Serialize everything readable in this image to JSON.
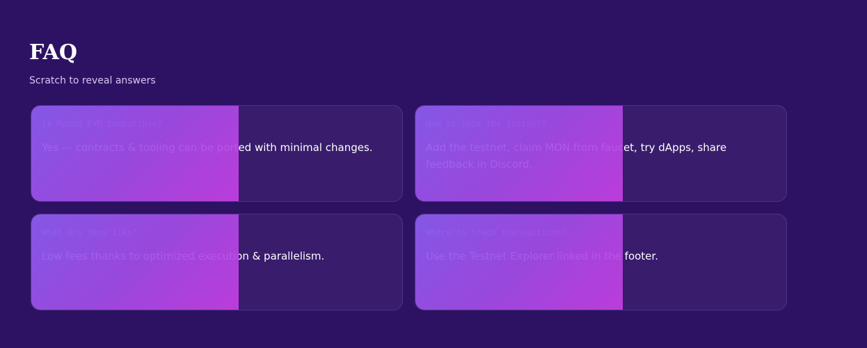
{
  "header": {
    "title": "FAQ",
    "subtitle": "Scratch to reveal answers"
  },
  "faq": [
    {
      "question": "Is Monad EVM compatible?",
      "answer": "Yes — contracts & tooling can be ported with minimal changes.",
      "scratch_revealed_percent": 44
    },
    {
      "question": "How to join the testnet?",
      "answer": "Add the testnet, claim MON from faucet, try dApps, share feedback in Discord.",
      "scratch_revealed_percent": 44
    },
    {
      "question": "What are fees like?",
      "answer": "Low fees thanks to optimized execution & parallelism.",
      "scratch_revealed_percent": 44
    },
    {
      "question": "Where to track transactions?",
      "answer": "Use the Testnet Explorer linked in the footer.",
      "scratch_revealed_percent": 44
    }
  ],
  "colors": {
    "background": "#2d1264",
    "card": "#391c6c",
    "scratch_start": "#8b5cf0",
    "scratch_end": "#c63fe3"
  }
}
